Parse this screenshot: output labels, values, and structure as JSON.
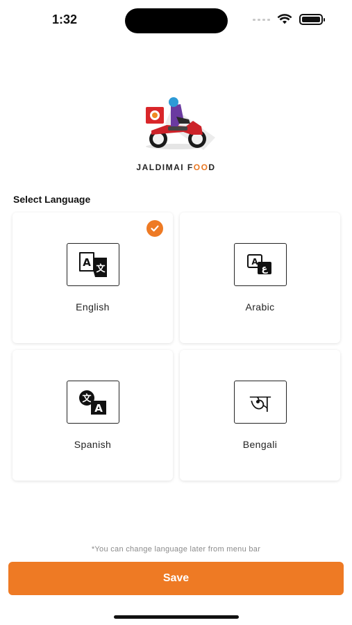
{
  "status_bar": {
    "time": "1:32",
    "wifi_icon": "wifi-icon",
    "battery_icon": "battery-icon",
    "battery_level": 1.0
  },
  "brand": {
    "part1": "JALDIMAI F",
    "accent": "OO",
    "part2": "D",
    "logo_icon": "delivery-scooter-icon"
  },
  "section_title": "Select Language",
  "languages": [
    {
      "label": "English",
      "icon": "translate-a-icon",
      "selected": true
    },
    {
      "label": "Arabic",
      "icon": "translate-arabic-icon",
      "selected": false
    },
    {
      "label": "Spanish",
      "icon": "translate-spanish-icon",
      "selected": false
    },
    {
      "label": "Bengali",
      "icon": "bengali-letter-icon",
      "selected": false
    }
  ],
  "hint": "*You can change language later from menu bar",
  "save_label": "Save",
  "colors": {
    "accent": "#ee7a24",
    "text": "#222222",
    "hint": "#8a8a8a"
  }
}
